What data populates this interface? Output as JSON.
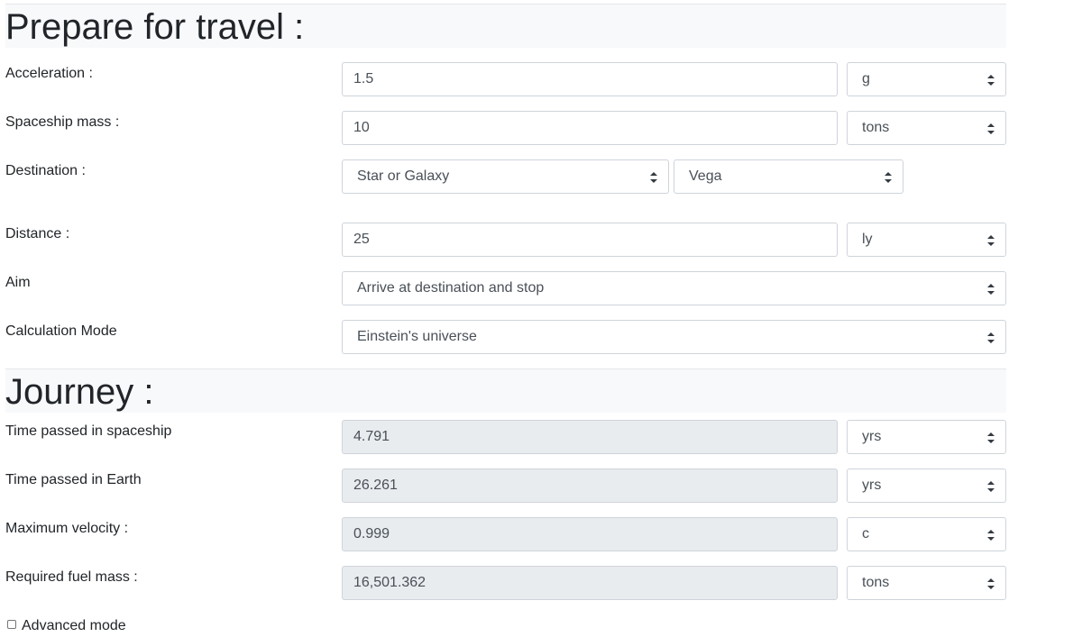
{
  "prepare": {
    "title": "Prepare for travel :",
    "acceleration": {
      "label": "Acceleration :",
      "value": "1.5",
      "unit": "g"
    },
    "mass": {
      "label": "Spaceship mass :",
      "value": "10",
      "unit": "tons"
    },
    "destination": {
      "label": "Destination :",
      "type": "Star or Galaxy",
      "target": "Vega"
    },
    "distance": {
      "label": "Distance :",
      "value": "25",
      "unit": "ly"
    },
    "aim": {
      "label": "Aim",
      "value": "Arrive at destination and stop"
    },
    "mode": {
      "label": "Calculation Mode",
      "value": "Einstein's universe"
    }
  },
  "journey": {
    "title": "Journey :",
    "ship_time": {
      "label": "Time passed in spaceship",
      "value": "4.791",
      "unit": "yrs"
    },
    "earth_time": {
      "label": "Time passed in Earth",
      "value": "26.261",
      "unit": "yrs"
    },
    "max_velocity": {
      "label": "Maximum velocity :",
      "value": "0.999",
      "unit": "c"
    },
    "fuel": {
      "label": "Required fuel mass :",
      "value": "16,501.362",
      "unit": "tons"
    }
  },
  "advanced": {
    "label": "Advanced mode",
    "checked": false
  }
}
